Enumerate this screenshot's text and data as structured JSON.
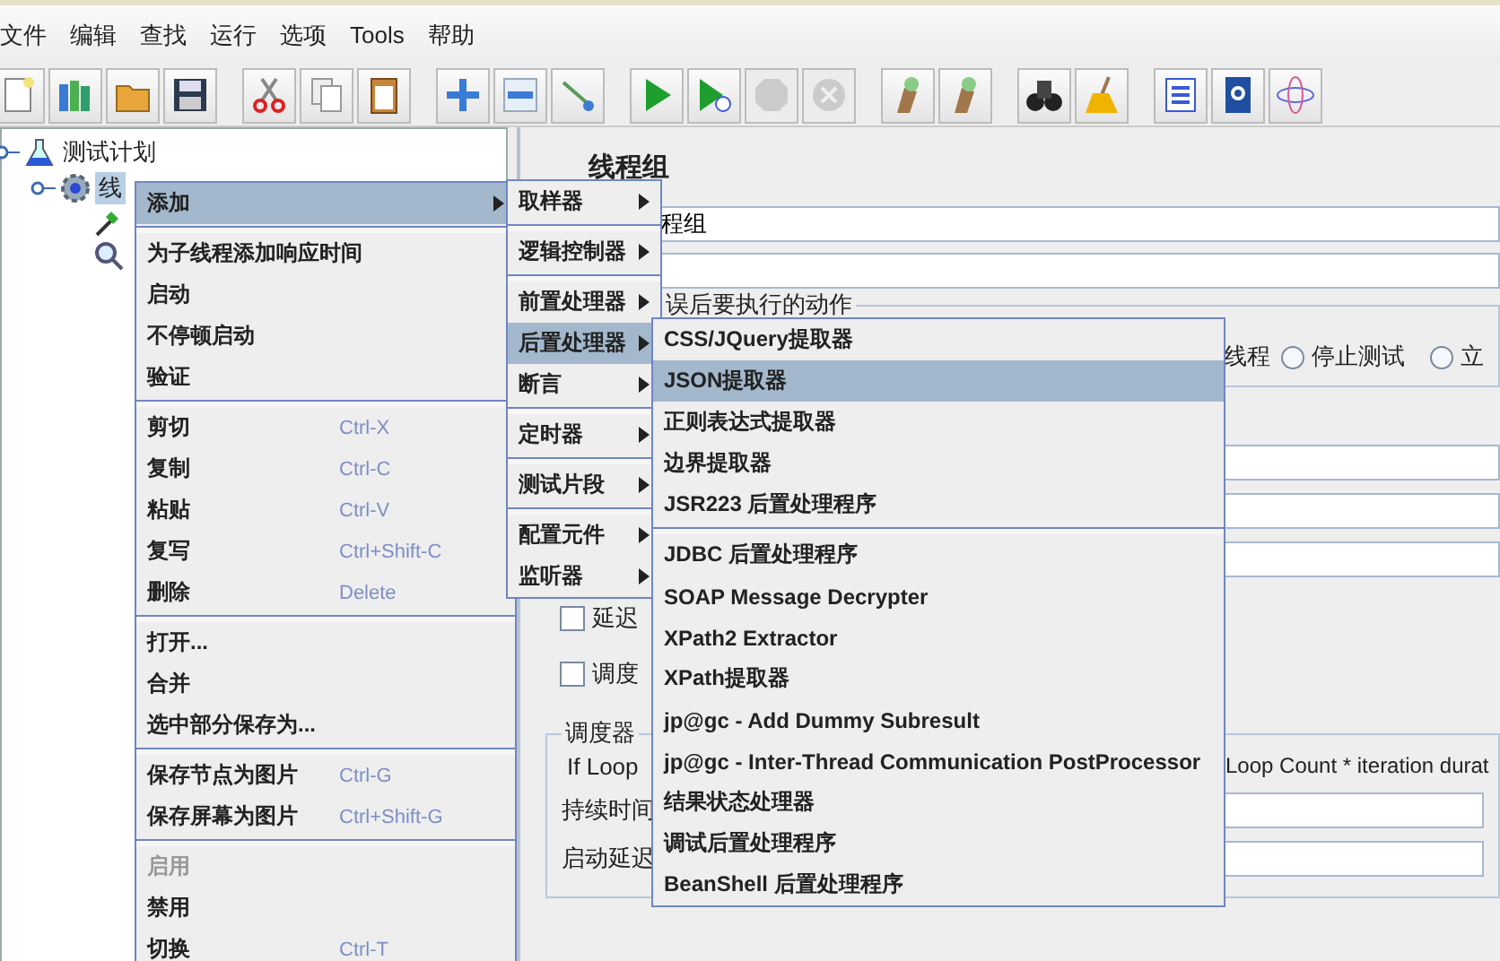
{
  "menu_bar": [
    "文件",
    "编辑",
    "查找",
    "运行",
    "选项",
    "Tools",
    "帮助"
  ],
  "toolbar": [
    [
      {
        "kind": "new",
        "disabled": false
      },
      {
        "kind": "templates",
        "disabled": false
      },
      {
        "kind": "open",
        "disabled": false
      },
      {
        "kind": "save",
        "disabled": false
      }
    ],
    [
      {
        "kind": "cut",
        "disabled": false
      },
      {
        "kind": "copy",
        "disabled": false
      },
      {
        "kind": "paste",
        "disabled": false
      }
    ],
    [
      {
        "kind": "expand",
        "disabled": false
      },
      {
        "kind": "collapse",
        "disabled": false
      },
      {
        "kind": "toggle",
        "disabled": false
      }
    ],
    [
      {
        "kind": "start",
        "disabled": false
      },
      {
        "kind": "start-no-pause",
        "disabled": false
      },
      {
        "kind": "stop",
        "disabled": true
      },
      {
        "kind": "shutdown",
        "disabled": true
      }
    ],
    [
      {
        "kind": "clear",
        "disabled": false
      },
      {
        "kind": "clear-all",
        "disabled": false
      }
    ],
    [
      {
        "kind": "search",
        "disabled": false
      },
      {
        "kind": "reset-search",
        "disabled": false
      }
    ],
    [
      {
        "kind": "function-helper",
        "disabled": false
      },
      {
        "kind": "help",
        "disabled": false
      },
      {
        "kind": "plugins",
        "disabled": false
      }
    ]
  ],
  "tree": [
    {
      "label": "测试计划",
      "kind": "plan",
      "selected": false,
      "children": [
        {
          "label": "线",
          "kind": "thread-group",
          "selected": true,
          "children": [
            {
              "kind": "extractor"
            },
            {
              "kind": "listener"
            }
          ]
        }
      ]
    }
  ],
  "context_menu": [
    {
      "kind": "submenu",
      "label": "添加",
      "selected": true
    },
    {
      "kind": "separator"
    },
    {
      "kind": "item",
      "label": "为子线程添加响应时间",
      "disabled": false
    },
    {
      "kind": "item",
      "label": "启动",
      "disabled": false
    },
    {
      "kind": "item",
      "label": "不停顿启动",
      "disabled": false
    },
    {
      "kind": "item",
      "label": "验证",
      "disabled": false
    },
    {
      "kind": "separator"
    },
    {
      "kind": "item",
      "label": "剪切",
      "shortcut": "Ctrl-X",
      "disabled": false
    },
    {
      "kind": "item",
      "label": "复制",
      "shortcut": "Ctrl-C",
      "disabled": false
    },
    {
      "kind": "item",
      "label": "粘贴",
      "shortcut": "Ctrl-V",
      "disabled": false
    },
    {
      "kind": "item",
      "label": "复写",
      "shortcut": "Ctrl+Shift-C",
      "disabled": false
    },
    {
      "kind": "item",
      "label": "删除",
      "shortcut": "Delete",
      "disabled": false
    },
    {
      "kind": "separator"
    },
    {
      "kind": "item",
      "label": "打开...",
      "disabled": false
    },
    {
      "kind": "item",
      "label": "合并",
      "disabled": false
    },
    {
      "kind": "item",
      "label": "选中部分保存为...",
      "disabled": false
    },
    {
      "kind": "separator"
    },
    {
      "kind": "item",
      "label": "保存节点为图片",
      "shortcut": "Ctrl-G",
      "disabled": false
    },
    {
      "kind": "item",
      "label": "保存屏幕为图片",
      "shortcut": "Ctrl+Shift-G",
      "disabled": false
    },
    {
      "kind": "separator"
    },
    {
      "kind": "item",
      "label": "启用",
      "disabled": true
    },
    {
      "kind": "item",
      "label": "禁用",
      "disabled": false
    },
    {
      "kind": "item",
      "label": "切换",
      "shortcut": "Ctrl-T",
      "disabled": false
    }
  ],
  "add_submenu": [
    {
      "kind": "submenu",
      "label": "取样器",
      "selected": false
    },
    {
      "kind": "separator"
    },
    {
      "kind": "submenu",
      "label": "逻辑控制器",
      "selected": false
    },
    {
      "kind": "separator"
    },
    {
      "kind": "submenu",
      "label": "前置处理器",
      "selected": false
    },
    {
      "kind": "submenu",
      "label": "后置处理器",
      "selected": true
    },
    {
      "kind": "submenu",
      "label": "断言",
      "selected": false
    },
    {
      "kind": "separator"
    },
    {
      "kind": "submenu",
      "label": "定时器",
      "selected": false
    },
    {
      "kind": "separator"
    },
    {
      "kind": "submenu",
      "label": "测试片段",
      "selected": false
    },
    {
      "kind": "separator"
    },
    {
      "kind": "submenu",
      "label": "配置元件",
      "selected": false
    },
    {
      "kind": "submenu",
      "label": "监听器",
      "selected": false
    }
  ],
  "post_processor_submenu": [
    {
      "kind": "item",
      "label": "CSS/JQuery提取器",
      "selected": false
    },
    {
      "kind": "item",
      "label": "JSON提取器",
      "selected": true
    },
    {
      "kind": "item",
      "label": "正则表达式提取器",
      "selected": false
    },
    {
      "kind": "item",
      "label": "边界提取器",
      "selected": false
    },
    {
      "kind": "item",
      "label": "JSR223 后置处理程序",
      "selected": false
    },
    {
      "kind": "separator"
    },
    {
      "kind": "item",
      "label": "JDBC 后置处理程序",
      "selected": false
    },
    {
      "kind": "item",
      "label": "SOAP Message Decrypter",
      "selected": false
    },
    {
      "kind": "item",
      "label": "XPath2 Extractor",
      "selected": false
    },
    {
      "kind": "item",
      "label": "XPath提取器",
      "selected": false
    },
    {
      "kind": "item",
      "label": "jp@gc - Add Dummy Subresult",
      "selected": false
    },
    {
      "kind": "item",
      "label": "jp@gc - Inter-Thread Communication PostProcessor",
      "selected": false
    },
    {
      "kind": "item",
      "label": "结果状态处理器",
      "selected": false
    },
    {
      "kind": "item",
      "label": "调试后置处理程序",
      "selected": false
    },
    {
      "kind": "item",
      "label": "BeanShell 后置处理程序",
      "selected": false
    }
  ],
  "panel": {
    "title": "线程组",
    "name_value": "程组",
    "error_action_legend": "误后要执行的动作",
    "error_actions": [
      {
        "label": "线程"
      },
      {
        "label": "停止测试",
        "selected": false
      },
      {
        "label": "立",
        "selected": false
      }
    ],
    "checkboxes": [
      {
        "label": "延迟",
        "checked": false
      },
      {
        "label": "调度",
        "checked": false
      }
    ],
    "scheduler_legend": "调度器",
    "warning_start": "If Loop",
    "warning_end": "Loop Count * iteration durat",
    "scheduler_fields": [
      {
        "label": "持续时间"
      },
      {
        "label": "启动延迟"
      }
    ]
  }
}
